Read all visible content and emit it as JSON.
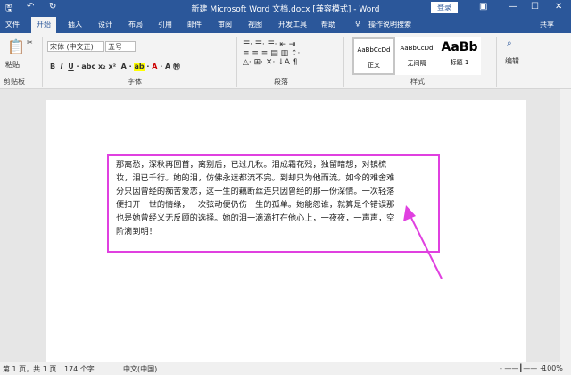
{
  "title": "新建 Microsoft Word 文档.docx [兼容模式] - Word",
  "login": "登录",
  "tabs": [
    "文件",
    "开始",
    "插入",
    "设计",
    "布局",
    "引用",
    "邮件",
    "审阅",
    "视图",
    "开发工具",
    "帮助",
    "操作说明搜索"
  ],
  "share": "共享",
  "ribbon": {
    "paste": "粘贴",
    "font_name": "宋体 (中文正)",
    "font_size": "五号",
    "clipboard": "剪贴板",
    "font": "字体",
    "paragraph": "段落",
    "styles": "样式",
    "edit": "编辑",
    "style_items": [
      {
        "preview": "AaBbCcDd",
        "name": "正文"
      },
      {
        "preview": "AaBbCcDd",
        "name": "无间隔"
      },
      {
        "preview": "AaBb",
        "name": "标题 1"
      }
    ]
  },
  "document": {
    "lines": [
      "那离愁，深秋再回首，离别后，已过几秋。泪成霜花残，独留暗想，对镜梳",
      "妆，泪已千行。她的泪，仿佛永远都流不完。到却只为他而流。如今的难舍难",
      "分只因曾经的痴苦爱恋，这一生的藕断丝连只因曾经的那一份深情。一次轻落",
      "便扣开一世的情缘，一次弦动便仍伤一生的孤单。她能怨谁，就算是个错误那",
      "也是她曾经义无反顾的选择。她的泪一滴滴打在他心上，一夜夜，一声声，空",
      "阶滴到明！"
    ]
  },
  "annotation_color": "#e040e0",
  "status": {
    "page": "第 1 页，共 1 页",
    "words": "174 个字",
    "lang": "中文(中国)",
    "zoom": "100%"
  }
}
